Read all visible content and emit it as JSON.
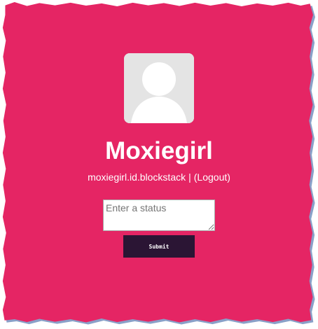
{
  "colors": {
    "page_background": "#e52564",
    "border_shadow": "#8aa0c8",
    "avatar_background": "#e4e4e4",
    "avatar_silhouette": "#ffffff",
    "submit_background": "#2b1534",
    "text": "#ffffff"
  },
  "profile": {
    "avatar_icon": "default-user-avatar-icon",
    "name": "Moxiegirl",
    "identity": "moxiegirl.id.blockstack",
    "separator": "|",
    "logout_label": "(Logout)"
  },
  "status_form": {
    "placeholder": "Enter a status",
    "value": "",
    "submit_label": "Submit"
  }
}
